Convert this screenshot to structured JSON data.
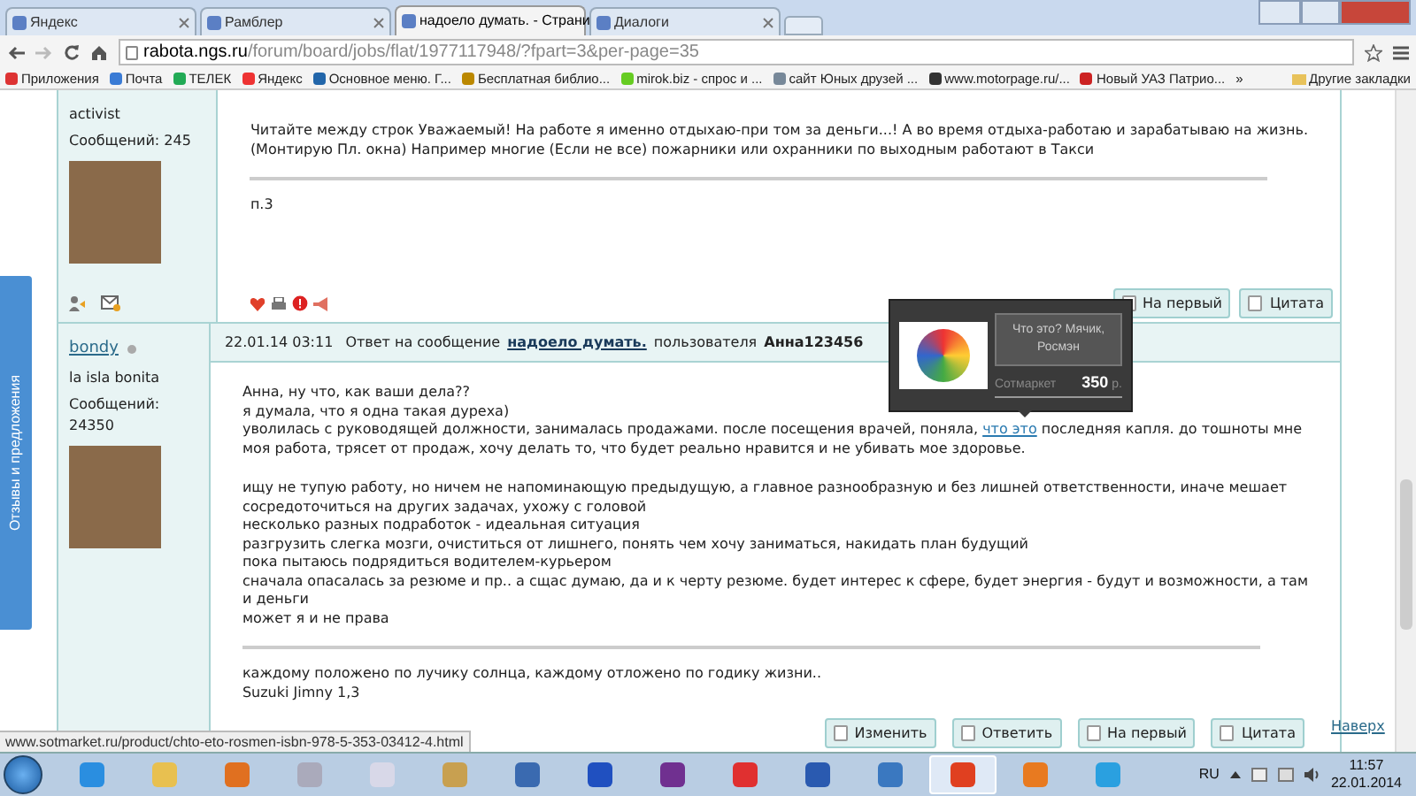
{
  "browser": {
    "tabs": [
      {
        "title": "Яндекс",
        "selected": false
      },
      {
        "title": "Рамблер",
        "selected": false
      },
      {
        "title": "надоело думать. - Страни",
        "selected": true
      },
      {
        "title": "Диалоги",
        "selected": false
      }
    ],
    "url_host": "rabota.ngs.ru",
    "url_path": "/forum/board/jobs/flat/1977117948/?fpart=3&per-page=35",
    "bookmarks": [
      "Приложения",
      "Почта",
      "ТЕЛЕК",
      "Яндекс",
      "Основное меню. Г...",
      "Бесплатная библио...",
      "mirok.biz - спрос и ...",
      "сайт Юных друзей ...",
      "www.motorpage.ru/...",
      "Новый УАЗ Патрио..."
    ],
    "bookmarks_more": "»",
    "other_bookmarks": "Другие закладки"
  },
  "feedback_tab": "Отзывы и предложения",
  "posts": [
    {
      "user": {
        "rank": "activist",
        "messages": "Сообщений: 245"
      },
      "paragraphs": [
        [
          "Читайте между строк Уважаемый! На работе я именно отдыхаю-при том за деньги...! А во время отдыха-работаю и зарабатываю на жизнь.",
          "(Монтирую Пл. окна) Например многие (Если не все) пожарники или охранники по выходным работают в Такси"
        ]
      ],
      "signature": [
        "п.3"
      ],
      "buttons": [
        "На первый",
        "Цитата"
      ]
    },
    {
      "user": {
        "name": "bondy",
        "online": false,
        "rank": "la isla bonita",
        "messages": "Сообщений: 24350"
      },
      "header": {
        "date": "22.01.14 03:11",
        "reply_prefix": "Ответ на сообщение",
        "reply_link": "надоело думать.",
        "user_prefix": "пользователя",
        "reply_user": "Анна123456"
      },
      "paragraphs": [
        [
          "Анна, ну что, как ваши дела??",
          "я думала, что я одна такая дуреха)",
          {
            "before": "уволилась с руководящей должности, занималась продажами. после посещения врачей, поняла,",
            "link": "что это",
            "after": "последняя капля. до тошноты мне"
          },
          "моя работа, трясет от продаж, хочу делать то, что будет реально нравится и не убивать мое здоровье."
        ],
        [
          "ищу не тупую работу, но ничем не напоминающую предыдущую, а главное разнообразную и без лишней ответственности, иначе мешает",
          "сосредоточиться на других задачах, ухожу с головой",
          "несколько разных подработок - идеальная ситуация",
          "разгрузить слегка мозги, очиститься от лишнего, понять чем хочу заниматься, накидать план будущий",
          "пока пытаюсь подрядиться водителем-курьером",
          "сначала опасалась за резюме и пр.. а сщас думаю, да и к черту резюме. будет интерес к сфере, будет энергия - будут и возможности, а там",
          "и деньги",
          "может я и не права"
        ]
      ],
      "signature": [
        "каждому положено по лучику солнца, каждому отложено по годику жизни..",
        "Suzuki Jimny 1,3"
      ],
      "buttons": [
        "Изменить",
        "Ответить",
        "На первый",
        "Цитата"
      ]
    }
  ],
  "popup": {
    "title": "Что это? Мячик, Росмэн",
    "shop": "Сотмаркет",
    "price": "350",
    "currency": "р."
  },
  "back_to_top": "Наверх",
  "status_url": "www.sotmarket.ru/product/chto-eto-rosmen-isbn-978-5-353-03412-4.html",
  "taskbar": {
    "apps": [
      {
        "selected": false
      },
      {
        "selected": false
      },
      {
        "selected": false
      },
      {
        "selected": false
      },
      {
        "selected": false
      },
      {
        "selected": false
      },
      {
        "selected": false
      },
      {
        "selected": false
      },
      {
        "selected": false
      },
      {
        "selected": false
      },
      {
        "selected": false
      },
      {
        "selected": false
      },
      {
        "selected": true
      },
      {
        "selected": false
      },
      {
        "selected": false
      }
    ],
    "language": "RU",
    "time": "11:57",
    "date": "22.01.2014"
  }
}
